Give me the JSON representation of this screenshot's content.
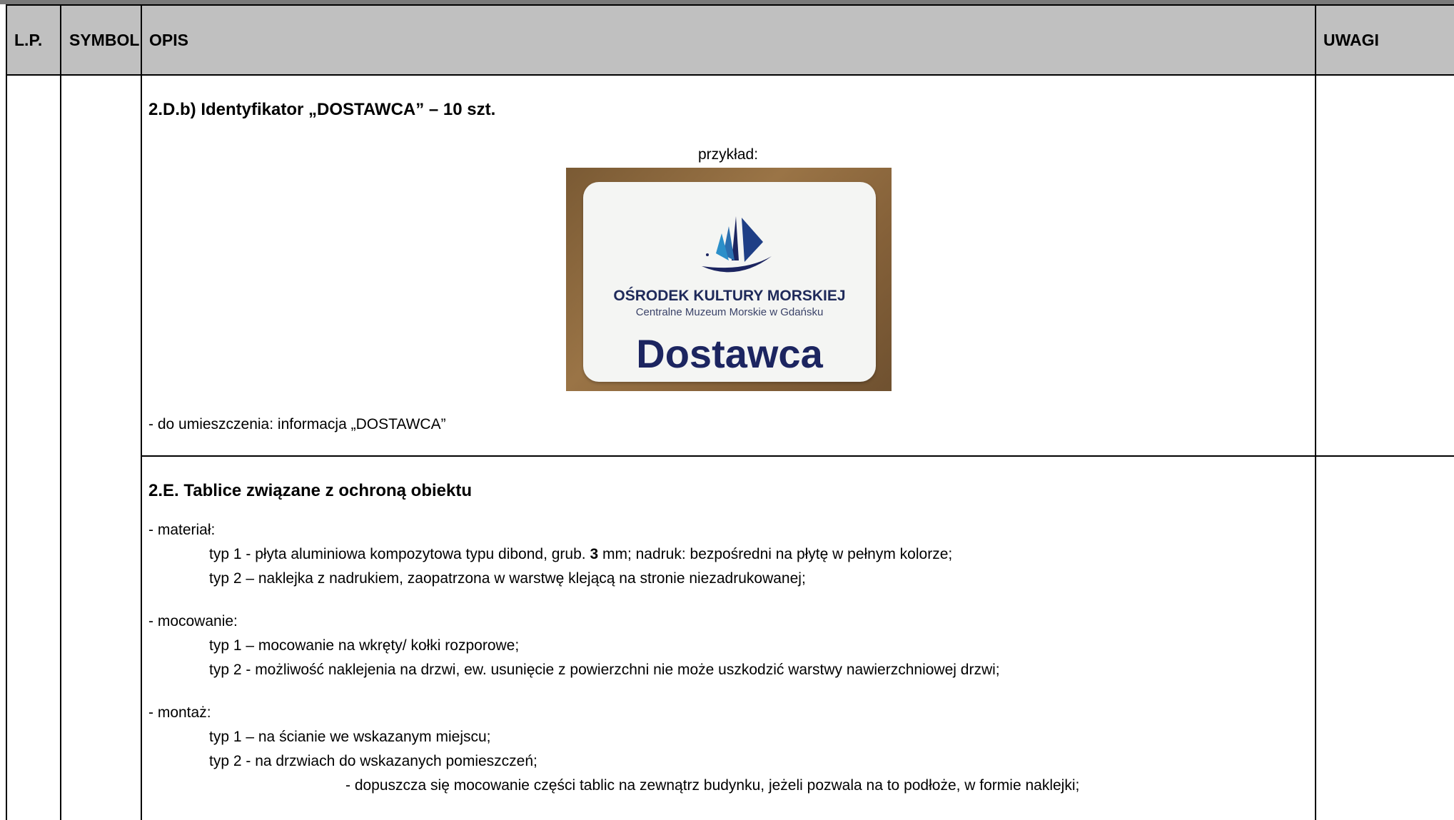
{
  "table_header": {
    "lp": "L.P.",
    "symbol": "SYMBOL",
    "opis": "OPIS",
    "uwagi": "UWAGI"
  },
  "section_d": {
    "title": "2.D.b) Identyfikator „DOSTAWCA” – 10 szt.",
    "example_label": "przykład:",
    "card": {
      "org": "OŚRODEK KULTURY MORSKIEJ",
      "sub": "Centralne Muzeum Morskie w Gdańsku",
      "main": "Dostawca",
      "brand_color": "#1c2560",
      "accent_color": "#2b8fc9"
    },
    "note": "- do umieszczenia: informacja „DOSTAWCA”"
  },
  "section_e": {
    "title": "2.E. Tablice związane z ochroną obiektu",
    "material": {
      "label": "- materiał:",
      "typ1_before": "typ 1 - płyta aluminiowa kompozytowa typu dibond, grub. ",
      "typ1_bold": "3",
      "typ1_after": " mm; nadruk: bezpośredni na płytę w pełnym kolorze;",
      "typ2": "typ 2 – naklejka z nadrukiem, zaopatrzona w warstwę klejącą na stronie niezadrukowanej;"
    },
    "mocowanie": {
      "label": "- mocowanie:",
      "typ1": "typ 1 – mocowanie na wkręty/ kołki rozporowe;",
      "typ2": "typ 2 - możliwość naklejenia na drzwi, ew. usunięcie z powierzchni nie może uszkodzić warstwy nawierzchniowej drzwi;"
    },
    "montaz": {
      "label": "- montaż:",
      "typ1": "typ 1 – na ścianie we wskazanym miejscu;",
      "typ2": "typ 2 - na drzwiach do wskazanych pomieszczeń;",
      "note": "- dopuszcza się mocowanie części tablic na zewnątrz budynku, jeżeli pozwala na to podłoże, w formie naklejki;"
    }
  }
}
